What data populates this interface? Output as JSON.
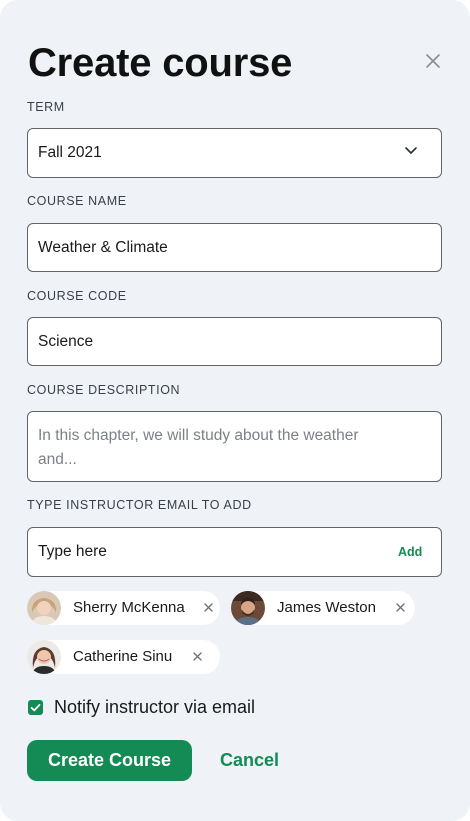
{
  "dialog": {
    "title": "Create course",
    "close_icon": "close-icon"
  },
  "term": {
    "label": "TERM",
    "value": "Fall 2021",
    "icon": "chevron-down-icon"
  },
  "course_name": {
    "label": "COURSE NAME",
    "value": "Weather & Climate"
  },
  "course_code": {
    "label": "COURSE CODE",
    "value": "Science"
  },
  "course_description": {
    "label": "COURSE DESCRIPTION",
    "placeholder_line1": "In this chapter, we will study about the weather",
    "placeholder_line2": "and..."
  },
  "instructor_email": {
    "label": "TYPE INSTRUCTOR EMAIL TO ADD",
    "placeholder": "Type here",
    "add_label": "Add"
  },
  "instructors": [
    {
      "name": "Sherry McKenna",
      "avatar": "avatar-photo",
      "remove_icon": "remove-icon"
    },
    {
      "name": "James Weston",
      "avatar": "avatar-photo",
      "remove_icon": "remove-icon"
    },
    {
      "name": "Catherine Sinu",
      "avatar": "avatar-photo",
      "remove_icon": "remove-icon"
    }
  ],
  "notify": {
    "label": "Notify instructor via email",
    "checked": true
  },
  "actions": {
    "primary_label": "Create Course",
    "secondary_label": "Cancel"
  },
  "colors": {
    "accent": "#148a55",
    "panel_bg": "#eff3f7",
    "border": "#5f6468"
  }
}
